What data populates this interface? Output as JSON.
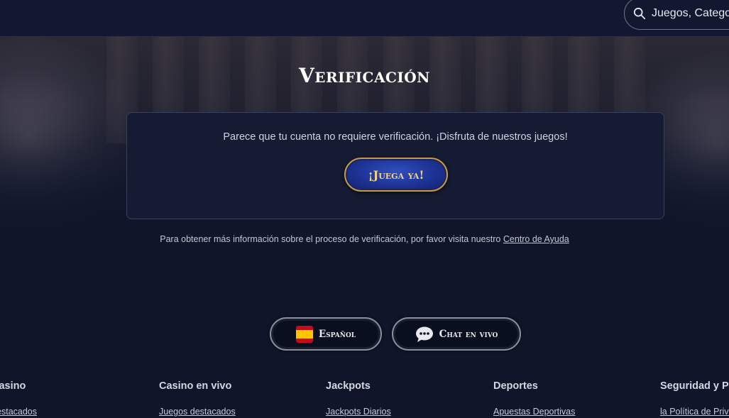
{
  "header": {
    "search": {
      "placeholder": "Juegos, Categorías"
    }
  },
  "main": {
    "title": "Verificación",
    "message": "Parece que tu cuenta no requiere verificación. ¡Disfruta de nuestros juegos!",
    "play_button": "¡Juega ya!",
    "info_text": "Para obtener más información sobre el proceso de verificación, por favor visita nuestro",
    "help_link": "Centro de Ayuda"
  },
  "actions": {
    "language": {
      "label": "Español",
      "icon": "spain-flag-icon"
    },
    "chat": {
      "label": "Chat en vivo",
      "icon": "chat-bubble-icon"
    }
  },
  "footer": {
    "columns": [
      {
        "heading": "Casino",
        "link": "Destacados"
      },
      {
        "heading": "Casino en vivo",
        "link": "Juegos destacados"
      },
      {
        "heading": "Jackpots",
        "link": "Jackpots Diarios"
      },
      {
        "heading": "Deportes",
        "link": "Apuestas Deportivas"
      },
      {
        "heading": "Seguridad y Privacidad",
        "link": "la Política de Privacidad"
      }
    ]
  },
  "colors": {
    "background": "#10162a",
    "card": "#151b32",
    "gold": "#c79a48",
    "button_blue": "#1d3394"
  }
}
